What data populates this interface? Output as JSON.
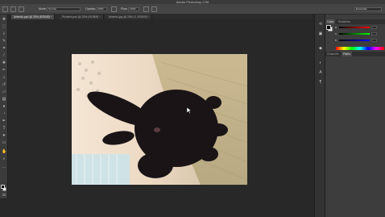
{
  "app": {
    "title": "Adobe Photoshop CS6"
  },
  "options_bar": {
    "mode_label": "Mode:",
    "mode_value": "Normal",
    "opacity_label": "Opacity:",
    "opacity_value": "100%",
    "flow_label": "Flow:",
    "flow_value": "100%",
    "workspace_value": "Essentials"
  },
  "tabs": [
    {
      "label": "Artemis.psd @ 25% (RGB/8) *",
      "active": true
    },
    {
      "label": "Prudent.psd @ 25% (RGB/8) *",
      "active": false
    },
    {
      "label": "Artemis.jpg @ 25% (1, RGB/8) *",
      "active": false
    }
  ],
  "panels": {
    "color_tab": "Color",
    "swatches_tab": "Swatches",
    "channels_tab": "Channels",
    "paths_tab": "Paths",
    "r_label": "R",
    "g_label": "G",
    "b_label": "B"
  },
  "colors": {
    "foreground": "#000000",
    "background": "#ffffff",
    "accent": "#4a4a4a"
  }
}
